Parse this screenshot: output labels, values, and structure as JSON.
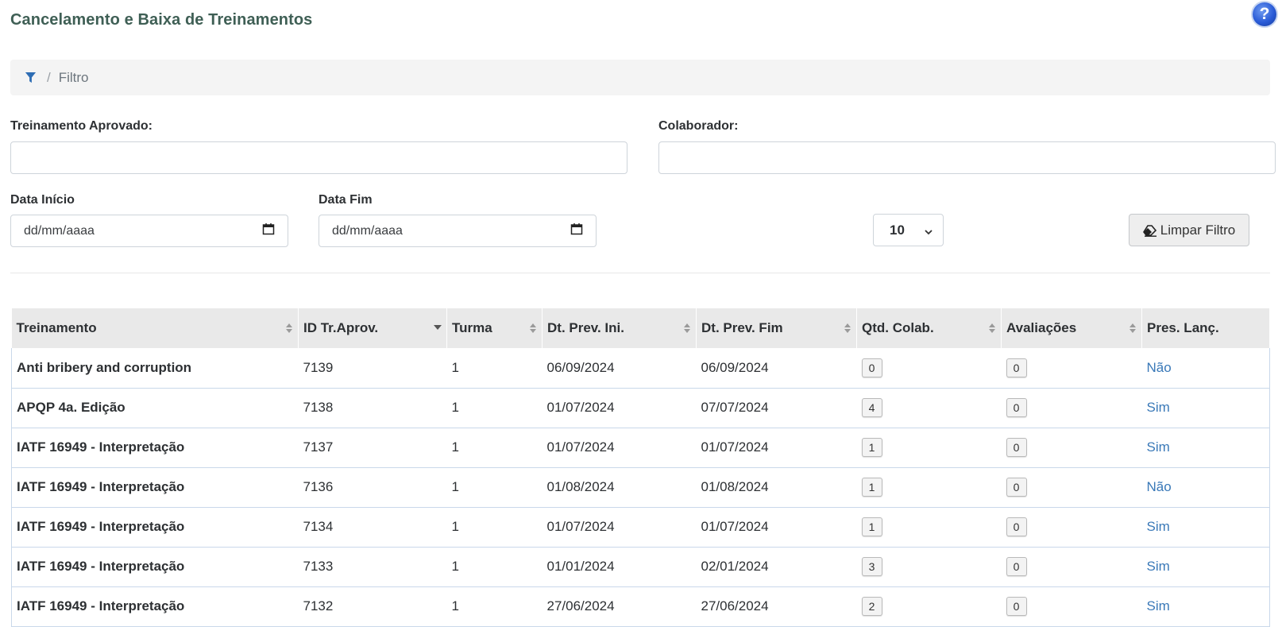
{
  "page": {
    "title": "Cancelamento e Baixa de Treinamentos",
    "help_label": "?"
  },
  "breadcrumb": {
    "label": "Filtro",
    "separator": "/"
  },
  "filters": {
    "treinamento_label": "Treinamento Aprovado:",
    "treinamento_value": "",
    "colaborador_label": "Colaborador:",
    "colaborador_value": "",
    "data_inicio_label": "Data Início",
    "data_inicio_placeholder": "dd/mm/aaaa",
    "data_fim_label": "Data Fim",
    "data_fim_placeholder": "dd/mm/aaaa",
    "page_size": "10",
    "clear_label": "Limpar Filtro"
  },
  "table": {
    "headers": [
      "Treinamento",
      "ID Tr.Aprov.",
      "Turma",
      "Dt. Prev. Ini.",
      "Dt. Prev. Fim",
      "Qtd. Colab.",
      "Avaliações",
      "Pres. Lanç."
    ],
    "rows": [
      {
        "treinamento": "Anti bribery and corruption",
        "id": "7139",
        "turma": "1",
        "ini": "06/09/2024",
        "fim": "06/09/2024",
        "qtd": "0",
        "aval": "0",
        "pres": "Não"
      },
      {
        "treinamento": "APQP 4a. Edição",
        "id": "7138",
        "turma": "1",
        "ini": "01/07/2024",
        "fim": "07/07/2024",
        "qtd": "4",
        "aval": "0",
        "pres": "Sim"
      },
      {
        "treinamento": "IATF 16949 - Interpretação",
        "id": "7137",
        "turma": "1",
        "ini": "01/07/2024",
        "fim": "01/07/2024",
        "qtd": "1",
        "aval": "0",
        "pres": "Sim"
      },
      {
        "treinamento": "IATF 16949 - Interpretação",
        "id": "7136",
        "turma": "1",
        "ini": "01/08/2024",
        "fim": "01/08/2024",
        "qtd": "1",
        "aval": "0",
        "pres": "Não"
      },
      {
        "treinamento": "IATF 16949 - Interpretação",
        "id": "7134",
        "turma": "1",
        "ini": "01/07/2024",
        "fim": "01/07/2024",
        "qtd": "1",
        "aval": "0",
        "pres": "Sim"
      },
      {
        "treinamento": "IATF 16949 - Interpretação",
        "id": "7133",
        "turma": "1",
        "ini": "01/01/2024",
        "fim": "02/01/2024",
        "qtd": "3",
        "aval": "0",
        "pres": "Sim"
      },
      {
        "treinamento": "IATF 16949 - Interpretação",
        "id": "7132",
        "turma": "1",
        "ini": "27/06/2024",
        "fim": "27/06/2024",
        "qtd": "2",
        "aval": "0",
        "pres": "Sim"
      }
    ]
  },
  "colors": {
    "title": "#3f5f55",
    "link": "#3a79b8",
    "funnel": "#2e6db4"
  }
}
